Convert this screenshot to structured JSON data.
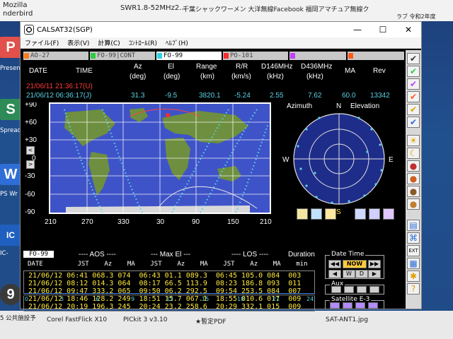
{
  "desktop": {
    "taskbar_top": [
      "Mozilla",
      "nderbird",
      "SWR1.8-52MHz2...",
      "千葉シャックワーメン 大洋無線Facebook 福岡アマチュア無線ク",
      "ラブ 令和2年度"
    ],
    "left_icons": [
      {
        "label": "Presen",
        "letter": "P",
        "color": "#e2504b"
      },
      {
        "label": "Spread",
        "letter": "S",
        "color": "#2e8b57"
      },
      {
        "label": "PS Wr",
        "letter": "W",
        "color": "#2f6ed6"
      },
      {
        "label": "IC-",
        "letter": "IC",
        "color": "#1f5fbf"
      },
      {
        "label": "5 公共施設予",
        "letter": "9",
        "color": "#3a3a3a"
      }
    ],
    "bottom_labels": [
      "Corel FastFlick X10",
      "PICkit 3 v3.10",
      "★暫定PDF",
      "SAT-ANT1.jpg"
    ]
  },
  "window": {
    "title": "CALSAT32(SGP)",
    "controls": {
      "minimize": "—",
      "maximize": "☐",
      "close": "✕"
    },
    "menu": [
      "ファイル(F)",
      "表示(V)",
      "計算(C)",
      "ｺﾝﾄﾛｰﾙ(R)",
      "ﾍﾙﾌﾟ(H)"
    ]
  },
  "satellites": [
    {
      "name": "AO-27",
      "color": "#ff7a1a",
      "active": false
    },
    {
      "name": "FO-99|CONT",
      "color": "#2ecc40",
      "active": false
    },
    {
      "name": "FO-99",
      "color": "#2ad4e0",
      "active": true
    },
    {
      "name": "PO-101",
      "color": "#ff2a2a",
      "active": false
    },
    {
      "name": "",
      "color": "#c040ff",
      "active": false
    },
    {
      "name": "",
      "color": "#ff5a1a",
      "active": false
    }
  ],
  "header": {
    "date_label": "DATE",
    "time_label": "TIME",
    "columns": [
      {
        "name": "Az",
        "unit": "(deg)",
        "value": "31.3"
      },
      {
        "name": "El",
        "unit": "(deg)",
        "value": "-9.5"
      },
      {
        "name": "Range",
        "unit": "(km)",
        "value": "3820.1"
      },
      {
        "name": "R/R",
        "unit": "(km/s)",
        "value": "-5.24"
      },
      {
        "name": "D146MHz",
        "unit": "(kHz)",
        "value": "2.55"
      },
      {
        "name": "D436MHz",
        "unit": "(kHz)",
        "value": "7.62"
      },
      {
        "name": "MA",
        "unit": "",
        "value": "60.0"
      },
      {
        "name": "Rev",
        "unit": "",
        "value": "13342"
      }
    ],
    "utc": "21/06/11 21:36:17(U)",
    "jst": "21/06/12 06:36:17(J)"
  },
  "map": {
    "y_ticks": [
      "+90",
      "+60",
      "+30",
      "0",
      "-30",
      "-60",
      "-90"
    ],
    "x_ticks": [
      "210",
      "270",
      "330",
      "30",
      "90",
      "150",
      "210"
    ],
    "nav_left": "<",
    "nav_right": ">"
  },
  "radar": {
    "azimuth_label": "Azimuth",
    "north_label": "N",
    "elevation_label": "Elevation",
    "west_label": "W",
    "east_label": "E",
    "south_label": "S"
  },
  "passes": {
    "satellite": "FO-99",
    "groups": {
      "aos": "---- AOS ----",
      "maxel": "--- Max El ---",
      "los": "---- LOS ----",
      "duration": "Duration"
    },
    "columns": "DATE         JST    Az    MA    JST    Az    MA    JST    Az    MA    min",
    "rows": [
      "21/06/12 06:41 068.3 074  06:43 01.1 089.3  06:45 105.0 084  003",
      "21/06/12 08:12 014.3 064  08:17 66.5 113.9  08:23 186.8 093  011",
      "21/06/12 09:47 333.2 065  09:50 06.2 292.5  09:54 253.5 084  007",
      "21/06/12 18:46 128.2 249  18:51 15.7 067.1  18:55 010.6 017  009",
      "21/06/12 20:19 196.3 245  20:24 23.2 258.6  20:29 332.1 015  009"
    ]
  },
  "timeline_ticks": [
    "0",
    "3",
    "6",
    "9",
    "12",
    "15",
    "18",
    "21",
    "24"
  ],
  "controls": {
    "date_time_label": "Date Time",
    "now_label": "NOW",
    "aux_label": "Aux",
    "satellite_label": "Satellite",
    "satellite_value": "E-3"
  },
  "colors": {
    "accent_cyan": "#5ad2e6",
    "utc_red": "#ff3b3b",
    "table_yellow": "#ffe83a"
  }
}
